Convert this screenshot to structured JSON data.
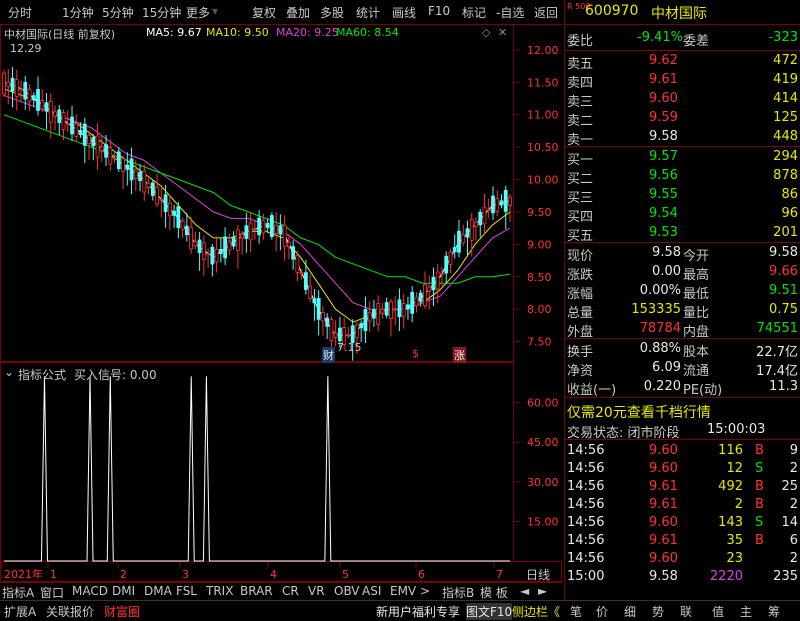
{
  "toolbar": {
    "left_items": [
      "分时",
      "1分钟",
      "5分钟",
      "15分钟",
      "更多"
    ],
    "right_items": [
      "复权",
      "叠加",
      "多股",
      "统计",
      "画线",
      "F10",
      "标记",
      "-自选",
      "返回"
    ]
  },
  "chart_header": {
    "title": "中材国际(日线 前复权)",
    "ma5": "MA5: 9.67",
    "ma10": "MA10: 9.50",
    "ma20": "MA20: 9.25",
    "ma60": "MA60: 8.54",
    "high_label": "12.29",
    "low_label": "7.15",
    "markers": [
      "财",
      "$",
      "涨"
    ]
  },
  "colors": {
    "up": "#ff3232",
    "down": "#54fcfc",
    "ma5": "#ffffff",
    "ma10": "#e8e800",
    "ma20": "#e040e0",
    "ma60": "#00e600",
    "frame": "#7a0000",
    "axis_text": "#ff3232"
  },
  "chart_data": [
    {
      "type": "line",
      "title": "中材国际(日线 前复权)",
      "price_axis_ticks": [
        12.0,
        11.5,
        11.0,
        10.5,
        10.0,
        9.5,
        9.0,
        8.5,
        8.0,
        7.5
      ],
      "ylim": [
        7.2,
        12.4
      ],
      "series": [
        {
          "name": "MA5",
          "values": [
            11.5,
            11.4,
            11.2,
            11.0,
            10.8,
            10.6,
            10.4,
            10.2,
            10.0,
            9.7,
            9.4,
            9.0,
            8.8,
            9.0,
            9.2,
            9.3,
            9.2,
            8.6,
            8.0,
            7.6,
            7.6,
            7.9,
            8.0,
            8.0,
            8.2,
            8.5,
            9.0,
            9.3,
            9.6,
            9.67
          ]
        },
        {
          "name": "MA10",
          "values": [
            11.4,
            11.3,
            11.2,
            11.0,
            10.9,
            10.7,
            10.5,
            10.3,
            10.1,
            9.9,
            9.6,
            9.3,
            9.1,
            9.1,
            9.2,
            9.2,
            9.1,
            8.8,
            8.4,
            8.0,
            7.8,
            7.9,
            8.0,
            8.0,
            8.1,
            8.3,
            8.6,
            9.0,
            9.3,
            9.5
          ]
        },
        {
          "name": "MA20",
          "values": [
            11.3,
            11.2,
            11.1,
            11.0,
            10.9,
            10.8,
            10.6,
            10.4,
            10.3,
            10.1,
            9.9,
            9.7,
            9.5,
            9.4,
            9.4,
            9.3,
            9.2,
            9.0,
            8.7,
            8.4,
            8.1,
            8.0,
            8.0,
            8.0,
            8.1,
            8.2,
            8.5,
            8.8,
            9.1,
            9.25
          ]
        },
        {
          "name": "MA60",
          "values": [
            11.0,
            10.9,
            10.8,
            10.7,
            10.6,
            10.5,
            10.4,
            10.3,
            10.2,
            10.1,
            10.0,
            9.9,
            9.8,
            9.6,
            9.5,
            9.4,
            9.3,
            9.1,
            9.0,
            8.8,
            8.7,
            8.6,
            8.5,
            8.5,
            8.4,
            8.4,
            8.4,
            8.5,
            8.5,
            8.54
          ]
        }
      ]
    },
    {
      "type": "line",
      "title": "指标公式 买入信号: 0.00",
      "y_axis_ticks": [
        60.0,
        45.0,
        30.0,
        15.0
      ],
      "ylim": [
        0,
        75
      ],
      "x_axis_ticks": [
        "2021年",
        "1",
        "2",
        "3",
        "4",
        "5",
        "6",
        "7"
      ],
      "signal_spike_positions": [
        0.08,
        0.17,
        0.21,
        0.37,
        0.4,
        0.64
      ],
      "spike_value": 70
    }
  ],
  "chart_panel": {
    "indicator_title": "指标公式",
    "indicator_value": "买入信号: 0.00",
    "period_label": "日线"
  },
  "stock": {
    "code": "600970",
    "name": "中材国际",
    "badge": "R 500"
  },
  "quote": {
    "weibi_label": "委比",
    "weibi": "-9.41%",
    "weicha_label": "委差",
    "weicha": "-323",
    "sell": [
      {
        "label": "卖五",
        "price": "9.62",
        "vol": "472"
      },
      {
        "label": "卖四",
        "price": "9.61",
        "vol": "419"
      },
      {
        "label": "卖三",
        "price": "9.60",
        "vol": "414"
      },
      {
        "label": "卖二",
        "price": "9.59",
        "vol": "125"
      },
      {
        "label": "卖一",
        "price": "9.58",
        "vol": "448"
      }
    ],
    "buy": [
      {
        "label": "买一",
        "price": "9.57",
        "vol": "294"
      },
      {
        "label": "买二",
        "price": "9.56",
        "vol": "878"
      },
      {
        "label": "买三",
        "price": "9.55",
        "vol": "86"
      },
      {
        "label": "买四",
        "price": "9.54",
        "vol": "96"
      },
      {
        "label": "买五",
        "price": "9.53",
        "vol": "201"
      }
    ],
    "stats": [
      {
        "l1": "现价",
        "v1": "9.58",
        "l2": "今开",
        "v2": "9.58"
      },
      {
        "l1": "涨跌",
        "v1": "0.00",
        "l2": "最高",
        "v2": "9.66"
      },
      {
        "l1": "涨幅",
        "v1": "0.00%",
        "l2": "最低",
        "v2": "9.51"
      },
      {
        "l1": "总量",
        "v1": "153335",
        "l2": "量比",
        "v2": "0.75"
      },
      {
        "l1": "外盘",
        "v1": "78784",
        "l2": "内盘",
        "v2": "74551"
      }
    ],
    "fin": [
      {
        "l1": "换手",
        "v1": "0.88%",
        "l2": "股本",
        "v2": "22.7亿"
      },
      {
        "l1": "净资",
        "v1": "6.09",
        "l2": "流通",
        "v2": "17.4亿"
      },
      {
        "l1": "收益(一)",
        "v1": "0.220",
        "l2": "PE(动)",
        "v2": "11.3"
      }
    ],
    "promo": "仅需20元查看千档行情",
    "trade_status_label": "交易状态: 闭市阶段",
    "trade_status_time": "15:00:03"
  },
  "ticks": [
    {
      "time": "14:56",
      "price": "9.60",
      "vol": "116",
      "side": "B",
      "num": "9"
    },
    {
      "time": "14:56",
      "price": "9.60",
      "vol": "12",
      "side": "S",
      "num": "2"
    },
    {
      "time": "14:56",
      "price": "9.61",
      "vol": "492",
      "side": "B",
      "num": "25"
    },
    {
      "time": "14:56",
      "price": "9.61",
      "vol": "2",
      "side": "B",
      "num": "2"
    },
    {
      "time": "14:56",
      "price": "9.60",
      "vol": "143",
      "side": "S",
      "num": "14"
    },
    {
      "time": "14:56",
      "price": "9.61",
      "vol": "35",
      "side": "B",
      "num": "6"
    },
    {
      "time": "14:56",
      "price": "9.60",
      "vol": "23",
      "side": "",
      "num": "2"
    },
    {
      "time": "15:00",
      "price": "9.58",
      "vol": "2220",
      "side": "",
      "num": "235"
    }
  ],
  "tabbar": {
    "items": [
      "指标A",
      "窗口",
      "MACD",
      "DMI",
      "DMA",
      "FSL",
      "TRIX",
      "BRAR",
      "CR",
      "VR",
      "OBV",
      "ASI",
      "EMV",
      ">",
      "指标B",
      "模 板",
      "◄",
      "►"
    ]
  },
  "statusbar": {
    "left": [
      "扩展A",
      "关联报价",
      "财富圈"
    ],
    "right": [
      "新用户福利专享",
      "图文F10",
      "侧边栏《",
      "笔",
      "价",
      "细",
      "势",
      "联",
      "值",
      "主",
      "筹"
    ]
  }
}
